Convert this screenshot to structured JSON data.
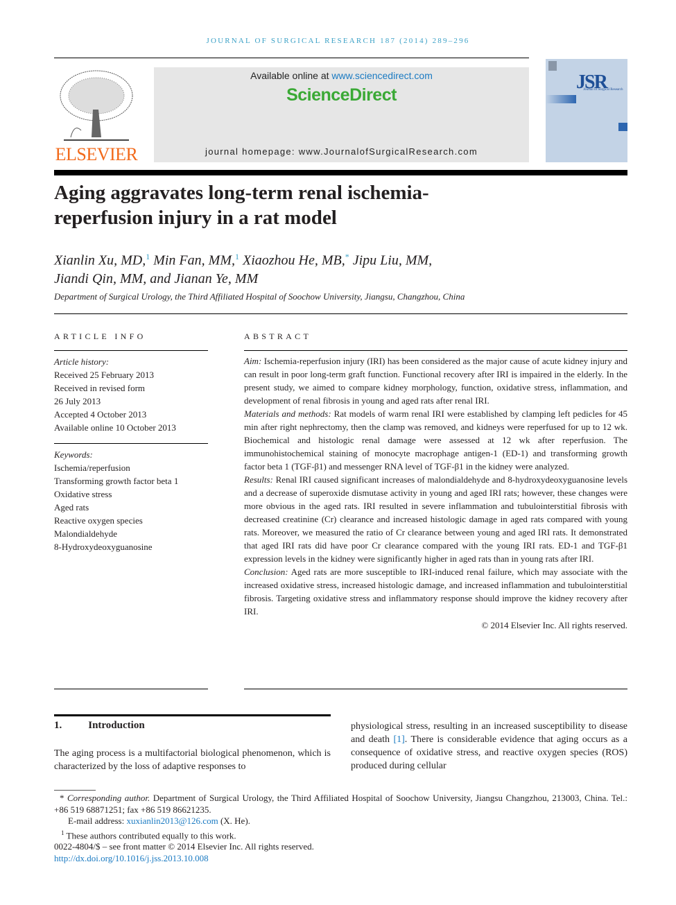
{
  "journal_line": "JOURNAL OF SURGICAL RESEARCH 187 (2014) 289–296",
  "header": {
    "available_prefix": "Available online at ",
    "available_link": "www.sciencedirect.com",
    "brand": "ScienceDirect",
    "homepage": "journal homepage: www.JournalofSurgicalResearch.com",
    "publisher_logo": "ELSEVIER",
    "cover_logo": "JSR",
    "cover_subtitle": "Journal of Surgical Research"
  },
  "title": "Aging aggravates long-term renal ischemia-reperfusion injury in a rat model",
  "authors": [
    {
      "name": "Xianlin Xu, MD,",
      "sup": "1"
    },
    {
      "name": " Min Fan, MM,",
      "sup": "1"
    },
    {
      "name": " Xiaozhou He, MB,",
      "sup": "*"
    },
    {
      "name": " Jipu Liu, MM,",
      "sup": ""
    },
    {
      "name": "Jiandi Qin, MM, and Jianan Ye, MM",
      "sup": ""
    }
  ],
  "affiliation": "Department of Surgical Urology, the Third Affiliated Hospital of Soochow University, Jiangsu, Changzhou, China",
  "article_info": {
    "heading": "ARTICLE INFO",
    "history_label": "Article history:",
    "history": [
      "Received 25 February 2013",
      "Received in revised form",
      "26 July 2013",
      "Accepted 4 October 2013",
      "Available online 10 October 2013"
    ],
    "keywords_label": "Keywords:",
    "keywords": [
      "Ischemia/reperfusion",
      "Transforming growth factor beta 1",
      "Oxidative stress",
      "Aged rats",
      "Reactive oxygen species",
      "Malondialdehyde",
      "8-Hydroxydeoxyguanosine"
    ]
  },
  "abstract": {
    "heading": "ABSTRACT",
    "sections": [
      {
        "label": "Aim:",
        "text": " Ischemia-reperfusion injury (IRI) has been considered as the major cause of acute kidney injury and can result in poor long-term graft function. Functional recovery after IRI is impaired in the elderly. In the present study, we aimed to compare kidney morphology, function, oxidative stress, inflammation, and development of renal fibrosis in young and aged rats after renal IRI."
      },
      {
        "label": "Materials and methods:",
        "text": " Rat models of warm renal IRI were established by clamping left pedicles for 45 min after right nephrectomy, then the clamp was removed, and kidneys were reperfused for up to 12 wk. Biochemical and histologic renal damage were assessed at 12 wk after reperfusion. The immunohistochemical staining of monocyte macrophage antigen-1 (ED-1) and transforming growth factor beta 1 (TGF-β1) and messenger RNA level of TGF-β1 in the kidney were analyzed."
      },
      {
        "label": "Results:",
        "text": " Renal IRI caused significant increases of malondialdehyde and 8-hydroxydeoxyguanosine levels and a decrease of superoxide dismutase activity in young and aged IRI rats; however, these changes were more obvious in the aged rats. IRI resulted in severe inflammation and tubulointerstitial fibrosis with decreased creatinine (Cr) clearance and increased histologic damage in aged rats compared with young rats. Moreover, we measured the ratio of Cr clearance between young and aged IRI rats. It demonstrated that aged IRI rats did have poor Cr clearance compared with the young IRI rats. ED-1 and TGF-β1 expression levels in the kidney were significantly higher in aged rats than in young rats after IRI."
      },
      {
        "label": "Conclusion:",
        "text": " Aged rats are more susceptible to IRI-induced renal failure, which may associate with the increased oxidative stress, increased histologic damage, and increased inflammation and tubulointerstitial fibrosis. Targeting oxidative stress and inflammatory response should improve the kidney recovery after IRI."
      }
    ],
    "copyright": "© 2014 Elsevier Inc. All rights reserved."
  },
  "intro": {
    "number": "1.",
    "heading": "Introduction",
    "left_text": "The aging process is a multifactorial biological phenomenon, which is characterized by the loss of adaptive responses to",
    "right_text_1": "physiological stress, resulting in an increased susceptibility to disease and death ",
    "ref": "[1]",
    "right_text_2": ". There is considerable evidence that aging occurs as a consequence of oxidative stress, and reactive oxygen species (ROS) produced during cellular"
  },
  "footnotes": {
    "corr_mark": "*",
    "corr_label": "Corresponding author.",
    "corr_text": " Department of Surgical Urology, the Third Affiliated Hospital of Soochow University, Jiangsu Changzhou, 213003, China. Tel.: +86 519 68871251; fax +86 519 86621235.",
    "email_label": "E-mail address: ",
    "email": "xuxianlin2013@126.com",
    "email_suffix": " (X. He).",
    "equal_mark": "1",
    "equal_text": " These authors contributed equally to this work.",
    "issn": "0022-4804/$ – see front matter © 2014 Elsevier Inc. All rights reserved.",
    "doi": "http://dx.doi.org/10.1016/j.jss.2013.10.008"
  }
}
